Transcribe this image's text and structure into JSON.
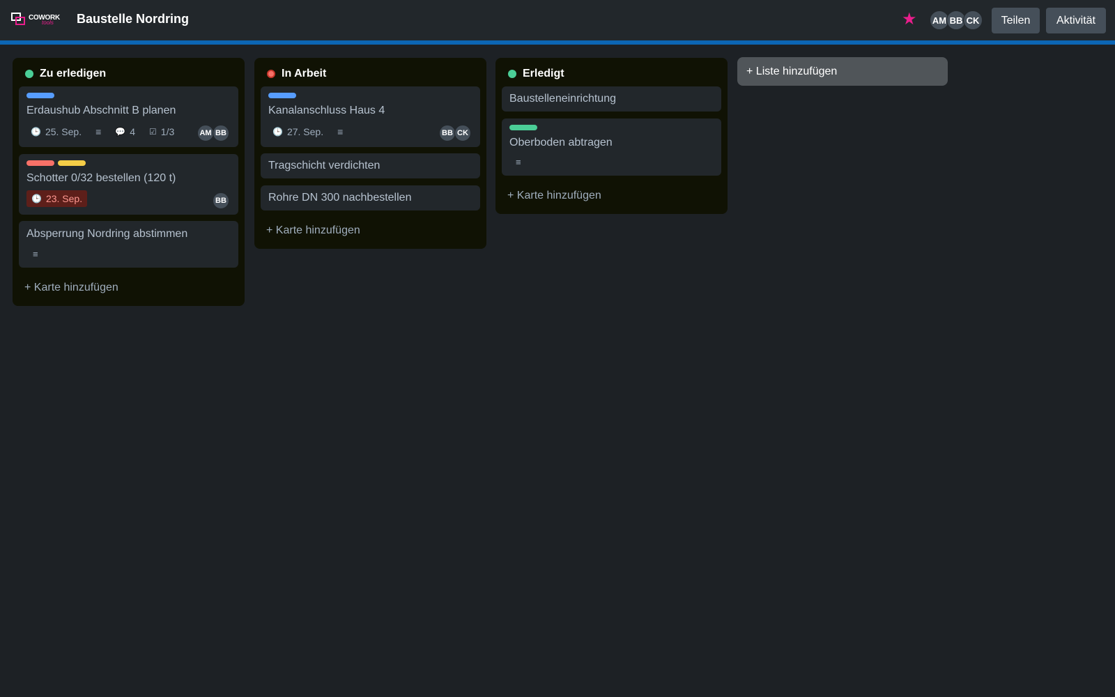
{
  "app": {
    "logo_text": "COWORK",
    "logo_sub": "tools",
    "board_title": "Baustelle Nordring"
  },
  "header": {
    "avatars": [
      "AM",
      "BB",
      "CK"
    ],
    "share_label": "Teilen",
    "activity_label": "Aktivität",
    "star_icon": "★"
  },
  "colors": {
    "accent": "#0c66b4",
    "brand": "#e91e8c",
    "label_blue": "#579dff",
    "label_red": "#f87168",
    "label_yellow": "#f5cd47",
    "label_green": "#4bce97"
  },
  "lists": [
    {
      "title": "Zu erledigen",
      "status_color": "#4bce97",
      "add_card": "+ Karte hinzufügen",
      "cards": [
        {
          "title": "Erdaushub Abschnitt B planen",
          "due": "25. Sep.",
          "comments": "4",
          "checklist": "1/3",
          "members": [
            "AM",
            "BB"
          ]
        },
        {
          "title": "Schotter 0/32 bestellen (120 t)",
          "due": "23. Sep.",
          "members": [
            "BB"
          ]
        },
        {
          "title": "Absperrung Nordring abstimmen"
        }
      ]
    },
    {
      "title": "In Arbeit",
      "status_color": "#f87168",
      "add_card": "+ Karte hinzufügen",
      "cards": [
        {
          "title": "Kanalanschluss Haus 4",
          "due": "27. Sep.",
          "members": [
            "BB",
            "CK"
          ]
        },
        {
          "title": "Tragschicht verdichten"
        },
        {
          "title": "Rohre DN 300 nachbestellen"
        }
      ]
    },
    {
      "title": "Erledigt",
      "status_color": "#4bce97",
      "add_card": "+ Karte hinzufügen",
      "cards": [
        {
          "title": "Baustelleneinrichtung"
        },
        {
          "title": "Oberboden abtragen"
        }
      ]
    }
  ],
  "add_list_label": "+ Liste hinzufügen"
}
